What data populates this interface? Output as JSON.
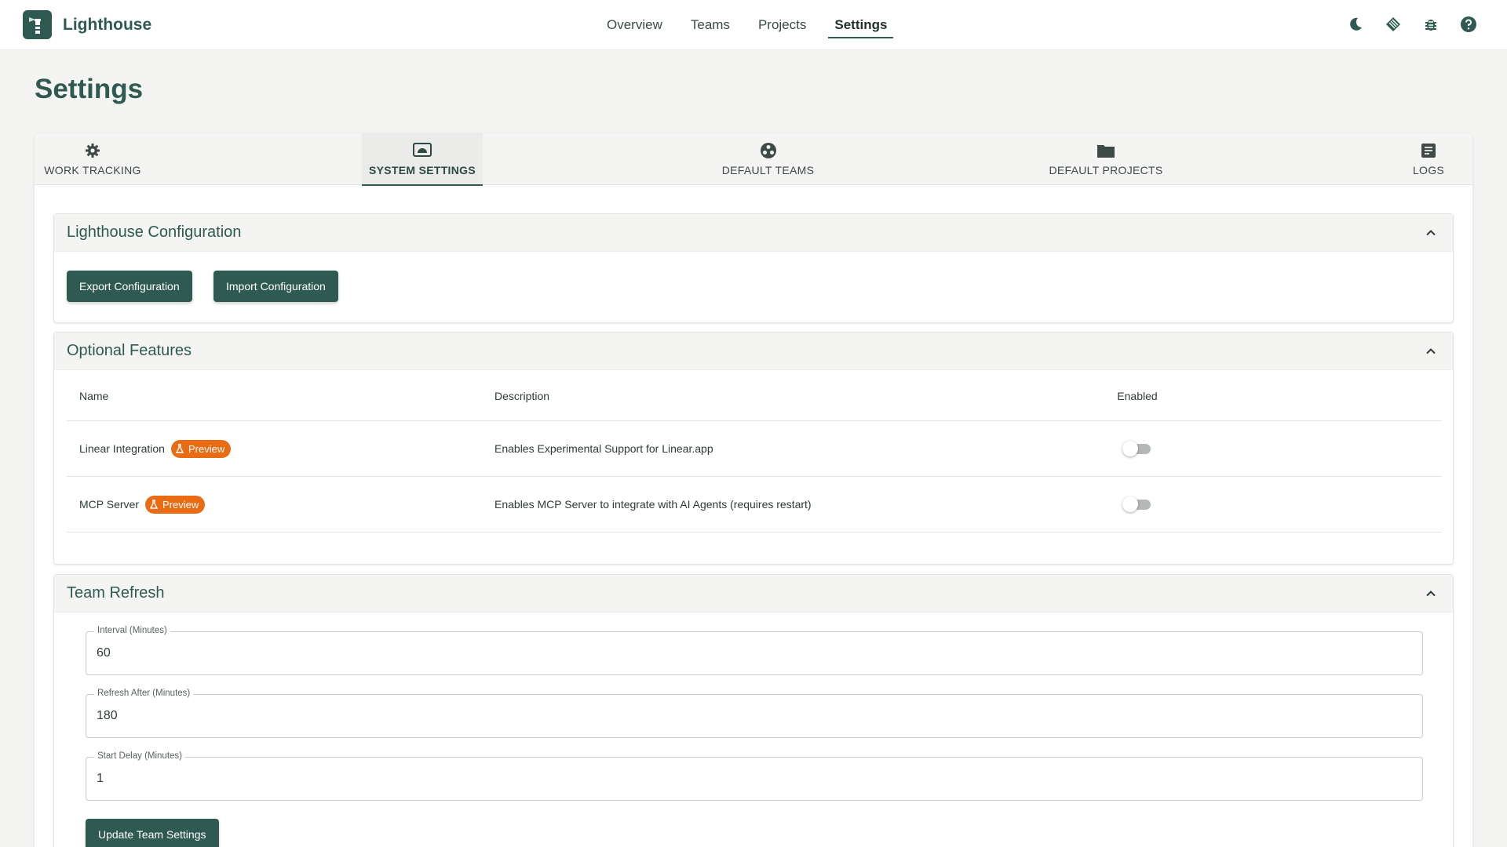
{
  "app": {
    "name": "Lighthouse",
    "logo_icon": "lighthouse-logo-icon"
  },
  "nav": {
    "items": [
      {
        "label": "Overview",
        "active": false
      },
      {
        "label": "Teams",
        "active": false
      },
      {
        "label": "Projects",
        "active": false
      },
      {
        "label": "Settings",
        "active": true
      }
    ]
  },
  "top_icons": [
    "dark-mode-moon-icon",
    "release-notes-icon",
    "bug-report-icon",
    "help-icon"
  ],
  "page": {
    "title": "Settings"
  },
  "tabs": [
    {
      "label": "WORK TRACKING",
      "icon": "gear-icon",
      "active": false
    },
    {
      "label": "SYSTEM SETTINGS",
      "icon": "system-settings-icon",
      "active": true
    },
    {
      "label": "DEFAULT TEAMS",
      "icon": "team-group-icon",
      "active": false
    },
    {
      "label": "DEFAULT PROJECTS",
      "icon": "folder-icon",
      "active": false
    },
    {
      "label": "LOGS",
      "icon": "document-icon",
      "active": false
    }
  ],
  "lighthouse_config": {
    "title": "Lighthouse Configuration",
    "export_label": "Export Configuration",
    "import_label": "Import Configuration"
  },
  "optional_features": {
    "title": "Optional Features",
    "columns": [
      "Name",
      "Description",
      "Enabled"
    ],
    "rows": [
      {
        "name": "Linear Integration",
        "badge": "Preview",
        "description": "Enables Experimental Support for Linear.app",
        "enabled": false
      },
      {
        "name": "MCP Server",
        "badge": "Preview",
        "description": "Enables MCP Server to integrate with AI Agents (requires restart)",
        "enabled": false
      }
    ]
  },
  "team_refresh": {
    "title": "Team Refresh",
    "fields": [
      {
        "label": "Interval (Minutes)",
        "value": "60"
      },
      {
        "label": "Refresh After (Minutes)",
        "value": "180"
      },
      {
        "label": "Start Delay (Minutes)",
        "value": "1"
      }
    ],
    "update_label": "Update Team Settings"
  },
  "colors": {
    "primary": "#2f5a52",
    "preview_badge": "#e96b13",
    "background": "#f4f4f3"
  }
}
